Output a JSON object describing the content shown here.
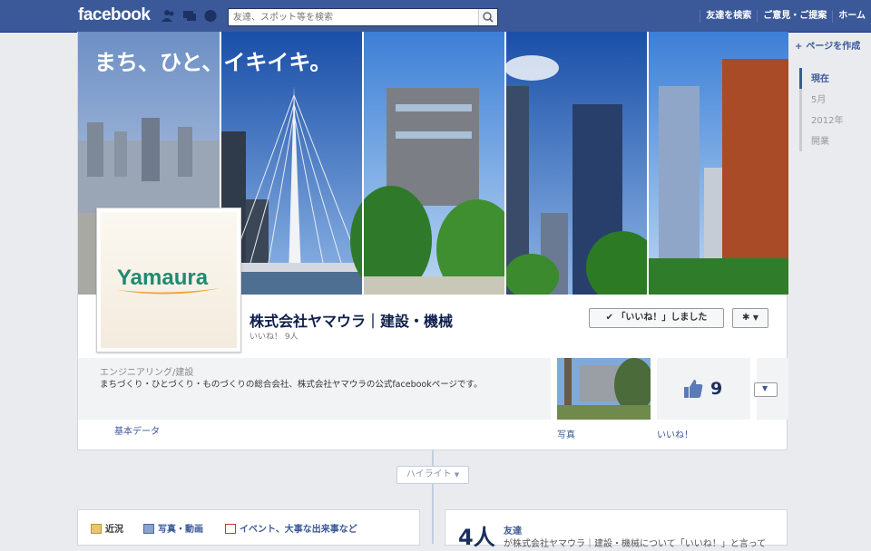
{
  "topbar": {
    "logo": "facebook",
    "search_placeholder": "友達、スポット等を検索",
    "nav": [
      "友達を検索",
      "ご意見・ご提案",
      "ホーム"
    ]
  },
  "rail": {
    "create_page": "ページを作成",
    "timeline": [
      "現在",
      "5月",
      "2012年",
      "開業"
    ]
  },
  "cover": {
    "tagline": "まち、ひと、イキイキ。"
  },
  "profile": {
    "logo_text": "Yamaura"
  },
  "page": {
    "name": "株式会社ヤマウラ｜建設・機械",
    "likes_line": "いいね！ 9人",
    "like_button": "「いいね！」しました",
    "category": "エンジニアリング/建設",
    "description": "まちづくり・ひとづくり・ものづくりの総合会社、株式会社ヤマウラの公式facebookページです。",
    "basic_data": "基本データ",
    "photos_label": "写真",
    "likes_number": "9",
    "likes_label": "いいね！"
  },
  "timeline": {
    "highlight": "ハイライト",
    "composer_tabs": [
      "近況",
      "写真・動画",
      "イベント、大事な出来事など"
    ],
    "friends_count": "4人",
    "friends_label": "友達",
    "friends_text": "が株式会社ヤマウラ｜建設・機械について「いいね！」と言って"
  },
  "colors": {
    "brand": "#3b5998",
    "link": "#3b5998",
    "logo_green": "#1f8a73",
    "logo_orange": "#f2a23a"
  }
}
